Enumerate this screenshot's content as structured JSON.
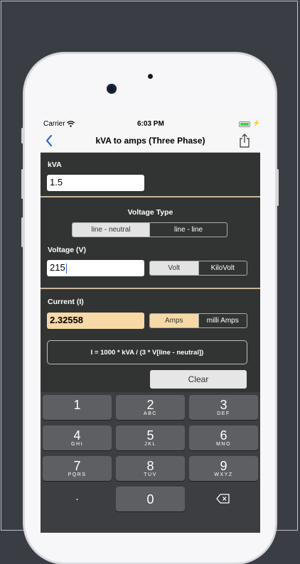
{
  "status_bar": {
    "carrier": "Carrier",
    "time": "6:03 PM"
  },
  "nav": {
    "title": "kVA to amps (Three Phase)",
    "back_icon": "chevron-left-icon",
    "share_icon": "share-icon"
  },
  "kva": {
    "label": "kVA",
    "value": "1.5"
  },
  "voltage_type": {
    "label": "Voltage Type",
    "options": [
      "line - neutral",
      "line - line"
    ],
    "selected": "line - neutral"
  },
  "voltage": {
    "label": "Voltage (V)",
    "value": "215",
    "units": [
      "Volt",
      "KiloVolt"
    ],
    "selected_unit": "Volt"
  },
  "current": {
    "label": "Current (I)",
    "value": "2.32558",
    "units": [
      "Amps",
      "milli Amps"
    ],
    "selected_unit": "Amps"
  },
  "formula": "I = 1000 * kVA / (3 * V[line - neutral])",
  "clear_label": "Clear",
  "keypad": [
    {
      "num": "1",
      "letters": ""
    },
    {
      "num": "2",
      "letters": "ABC"
    },
    {
      "num": "3",
      "letters": "DEF"
    },
    {
      "num": "4",
      "letters": "GHI"
    },
    {
      "num": "5",
      "letters": "JKL"
    },
    {
      "num": "6",
      "letters": "MNO"
    },
    {
      "num": "7",
      "letters": "PQRS"
    },
    {
      "num": "8",
      "letters": "TUV"
    },
    {
      "num": "9",
      "letters": "WXYZ"
    },
    {
      "num": ".",
      "letters": ""
    },
    {
      "num": "0",
      "letters": ""
    }
  ],
  "colors": {
    "accent": "#f6d9a6",
    "background": "#323333",
    "link": "#2f6bd8"
  }
}
